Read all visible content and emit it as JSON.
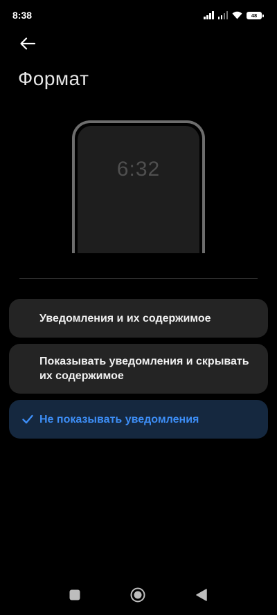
{
  "status_bar": {
    "time": "8:38",
    "battery": "48",
    "icons": [
      "signal-icon",
      "signal-icon",
      "wifi-icon",
      "battery-icon"
    ]
  },
  "header": {
    "back_icon": "arrow-left-icon",
    "title": "Формат"
  },
  "preview": {
    "clock": "6:32"
  },
  "options": [
    {
      "label": "Уведомления и их содержимое",
      "selected": false
    },
    {
      "label": "Показывать уведомления и скрывать их содержимое",
      "selected": false
    },
    {
      "label": "Не показывать уведомления",
      "selected": true,
      "icon": "checkmark-icon"
    }
  ],
  "nav_bar": {
    "icons": [
      "recents-square-icon",
      "home-circle-icon",
      "back-triangle-icon"
    ]
  },
  "colors": {
    "background": "#000000",
    "option_background": "#242424",
    "selected_background": "#15283f",
    "accent": "#3d8ef6"
  }
}
